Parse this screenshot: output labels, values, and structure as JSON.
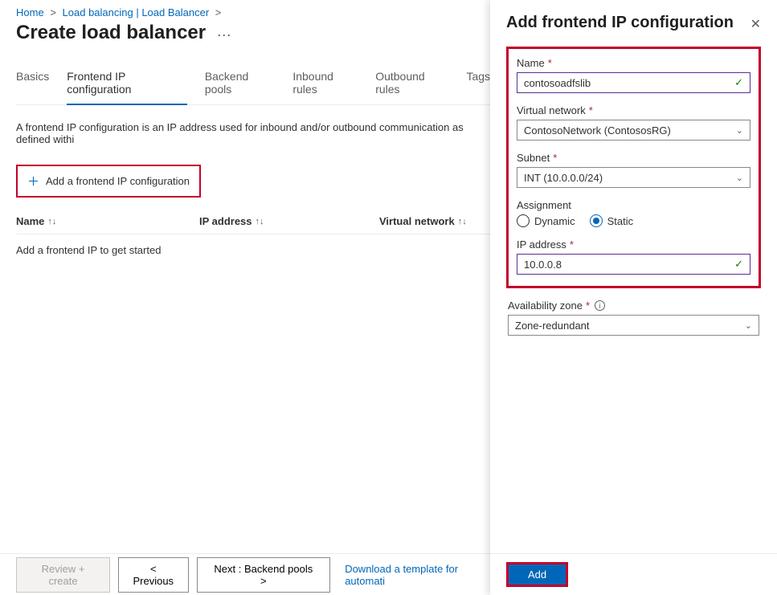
{
  "breadcrumb": {
    "home": "Home",
    "lb": "Load balancing | Load Balancer"
  },
  "page_title": "Create load balancer",
  "tabs": {
    "basics": "Basics",
    "frontend": "Frontend IP configuration",
    "backend": "Backend pools",
    "inbound": "Inbound rules",
    "outbound": "Outbound rules",
    "tags": "Tags"
  },
  "desc": "A frontend IP configuration is an IP address used for inbound and/or outbound communication as defined withi",
  "add_frontend_btn": "Add a frontend IP configuration",
  "cols": {
    "name": "Name",
    "ip": "IP address",
    "vn": "Virtual network"
  },
  "empty_row": "Add a frontend IP to get started",
  "footer": {
    "review": "Review + create",
    "prev": "< Previous",
    "next": "Next : Backend pools >",
    "template": "Download a template for automati"
  },
  "panel": {
    "title": "Add frontend IP configuration",
    "name_label": "Name",
    "name_value": "contosoadfslib",
    "vnet_label": "Virtual network",
    "vnet_value": "ContosoNetwork (ContososRG)",
    "subnet_label": "Subnet",
    "subnet_value": "INT (10.0.0.0/24)",
    "assignment_label": "Assignment",
    "assignment_dynamic": "Dynamic",
    "assignment_static": "Static",
    "ip_label": "IP address",
    "ip_value": "10.0.0.8",
    "avail_label": "Availability zone",
    "avail_value": "Zone-redundant",
    "add_btn": "Add"
  }
}
